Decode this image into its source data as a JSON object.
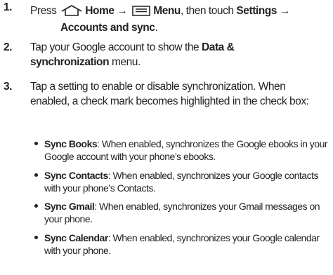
{
  "steps": [
    {
      "number": "1.",
      "text_press": "Press",
      "home_label": "Home",
      "arrow1": "→",
      "menu_label": "Menu",
      "text_then": ", then touch",
      "settings_label": "Settings",
      "arrow2": "→",
      "accounts_label": "Accounts and sync",
      "end": "."
    },
    {
      "number": "2.",
      "text_before": "Tap your Google account to show the",
      "menu_name": "Data & synchronization",
      "text_after": "menu."
    },
    {
      "number": "3.",
      "text": "Tap a setting to enable or disable synchronization. When enabled, a check mark becomes highlighted in the check box:"
    }
  ],
  "bullets": [
    {
      "title": "Sync Books",
      "text": ": When enabled, synchronizes the Google ebooks in your Google account with your phone’s ebooks."
    },
    {
      "title": "Sync Contacts",
      "text": ": When enabled, synchronizes your Google contacts with your phone’s Contacts."
    },
    {
      "title": "Sync Gmail",
      "text": ": When enabled, synchronizes your Gmail messages on your phone."
    },
    {
      "title": "Sync Calendar",
      "text": ": When enabled, synchronizes your Google calendar with your phone."
    }
  ],
  "icons": {
    "home": "home-icon",
    "menu": "menu-icon"
  }
}
